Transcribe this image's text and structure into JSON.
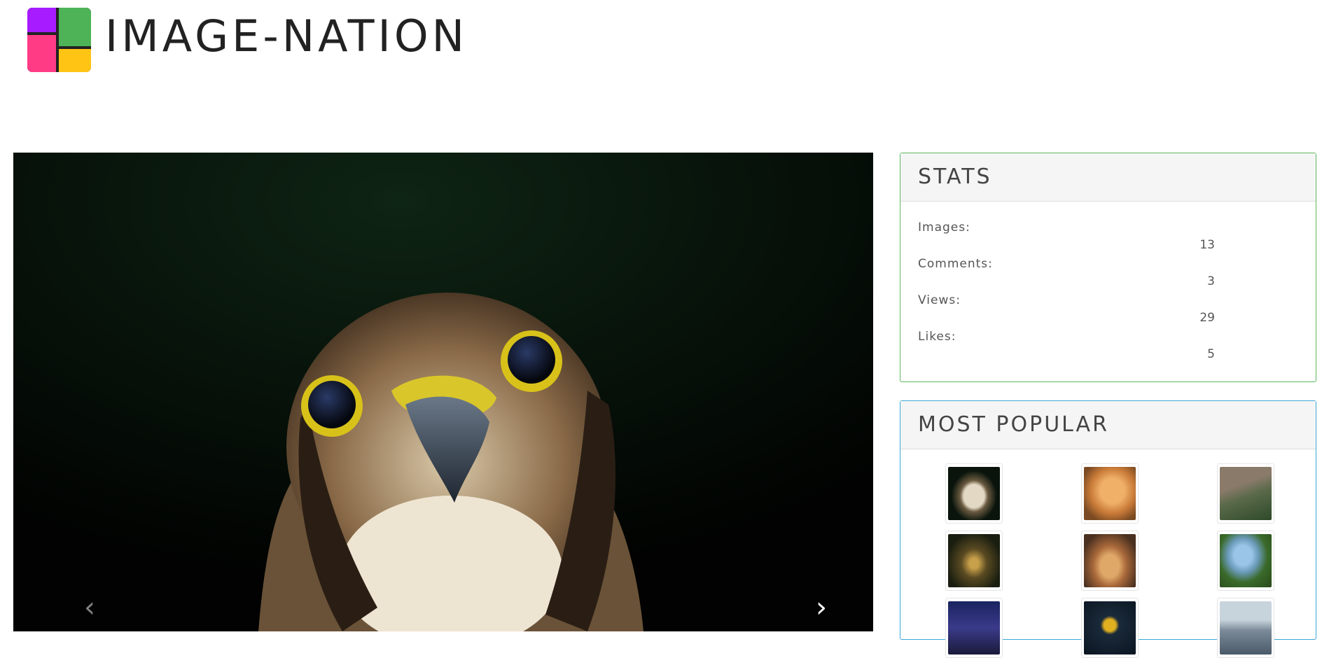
{
  "brand": {
    "name": "IMAGE-NATION",
    "logo_icon": "four-square-logo"
  },
  "carousel": {
    "prev_icon": "chevron-left-icon",
    "next_icon": "chevron-right-icon",
    "prev_glyph": "‹",
    "next_glyph": "›"
  },
  "stats": {
    "title": "STATS",
    "rows": [
      {
        "label": "Images:",
        "value": "13"
      },
      {
        "label": "Comments:",
        "value": "3"
      },
      {
        "label": "Views:",
        "value": "29"
      },
      {
        "label": "Likes:",
        "value": "5"
      }
    ]
  },
  "popular": {
    "title": "MOST POPULAR"
  },
  "colors": {
    "stats_border": "#5cb85c",
    "popular_border": "#3ca8d8",
    "logo_purple": "#a61bff",
    "logo_green": "#4db356",
    "logo_pink": "#ff3b86",
    "logo_yellow": "#ffc414"
  }
}
